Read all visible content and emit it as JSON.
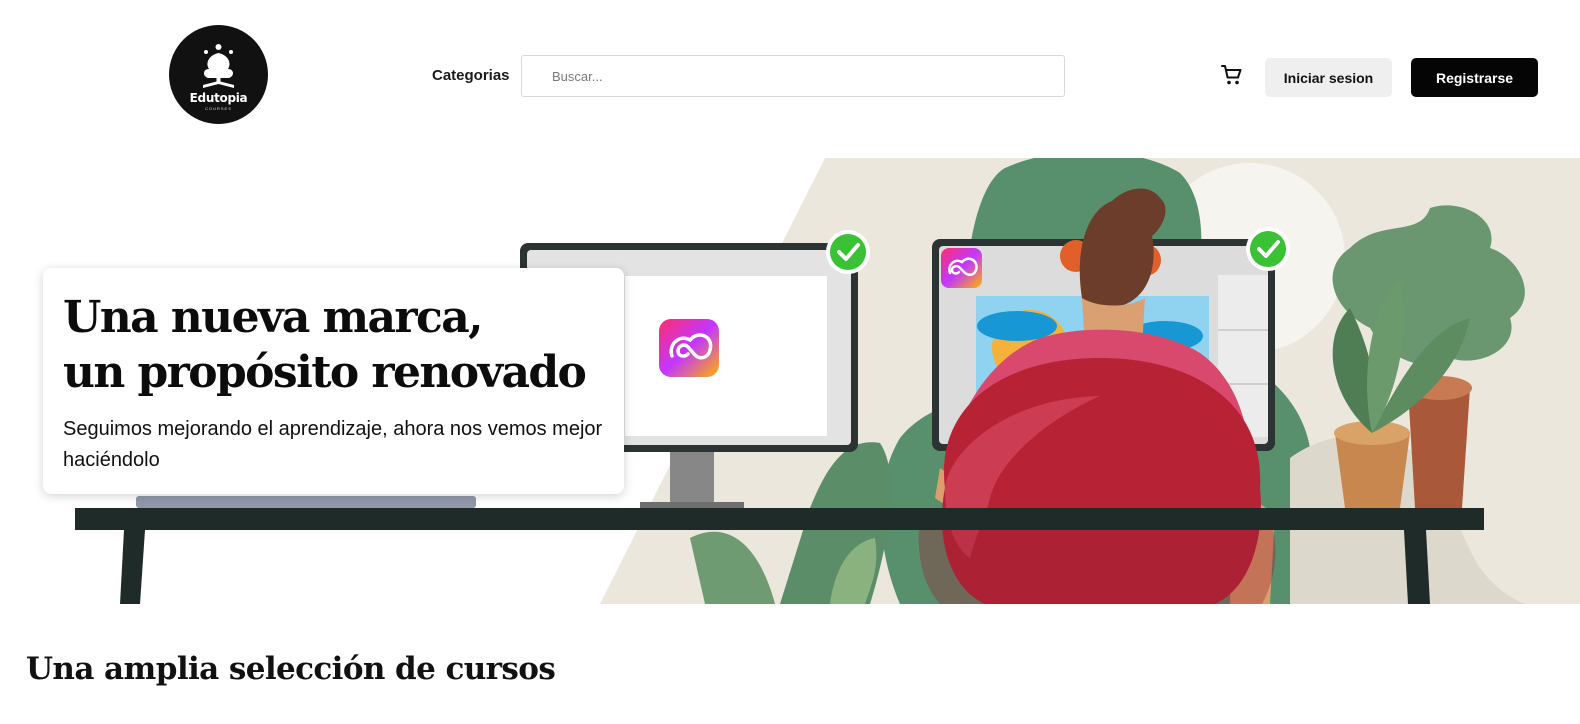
{
  "header": {
    "logo_text": "Edutopia",
    "logo_subtext": "COURSES",
    "categories_label": "Categorias",
    "search": {
      "placeholder": "Buscar...",
      "value": ""
    },
    "cart_icon": "shopping-cart-icon",
    "login_label": "Iniciar sesion",
    "register_label": "Registrarse"
  },
  "hero": {
    "title_line1": "Una nueva marca,",
    "title_line2": "un propósito renovado",
    "subtitle": "Seguimos mejorando el aprendizaje, ahora nos vemos mejor haciéndolo",
    "illustration_icons": [
      "check-icon",
      "creative-cloud-icon"
    ]
  },
  "section": {
    "title": "Una amplia selección de cursos"
  },
  "colors": {
    "primary_button": "#050505",
    "secondary_button": "#efefef",
    "check_green": "#3ac135",
    "sweater_red": "#b72335"
  }
}
